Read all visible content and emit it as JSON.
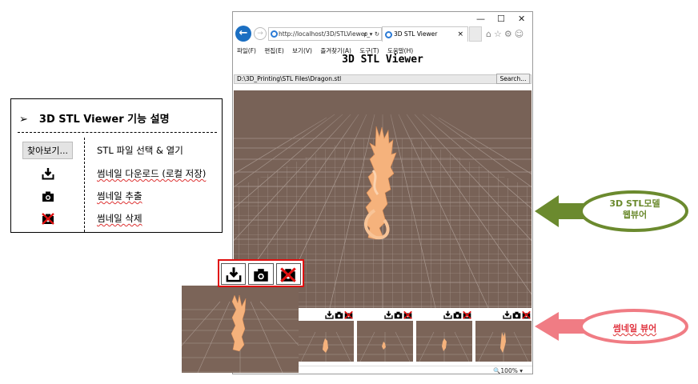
{
  "legend": {
    "bullet": "➢",
    "title": "3D STL Viewer 기능 설명",
    "rows": [
      {
        "button": "찾아보기...",
        "desc": "STL 파일 선택 & 열기"
      },
      {
        "icon": "download-icon",
        "desc": "썸네일 다운로드 (로컬 저장)"
      },
      {
        "icon": "camera-icon",
        "desc": "썸네일 추출"
      },
      {
        "icon": "delete-icon",
        "desc": "썸네일 삭제"
      }
    ]
  },
  "browser": {
    "window_controls": [
      "—",
      "☐",
      "✕"
    ],
    "address": "http://localhost/3D/STLViewer_",
    "address_tools": "ρ ▾ ↻",
    "tab_title": "3D STL Viewer",
    "tab_close": "×",
    "toolbar_icons": "⌂☆⚙☺",
    "menu": [
      "파일(F)",
      "편집(E)",
      "보기(V)",
      "즐겨찾기(A)",
      "도구(T)",
      "도움말(H)"
    ],
    "page_title": "3D STL Viewer",
    "file_path": "D:\\3D_Printing\\STL Files\\Dragon.stl",
    "search_button": "Search...",
    "zoom": "🔍100%  ▾",
    "thumbnail_count": 4
  },
  "callouts": {
    "webviewer_label": "3D STL모델\n웹뷰어",
    "thumbviewer_label": "썸네일 뷰어"
  },
  "colors": {
    "viewer_bg": "#786257",
    "model": "#f5b27c",
    "green_callout": "#6b8a2e",
    "pink_callout": "#f07c84",
    "highlight": "#e01010"
  }
}
